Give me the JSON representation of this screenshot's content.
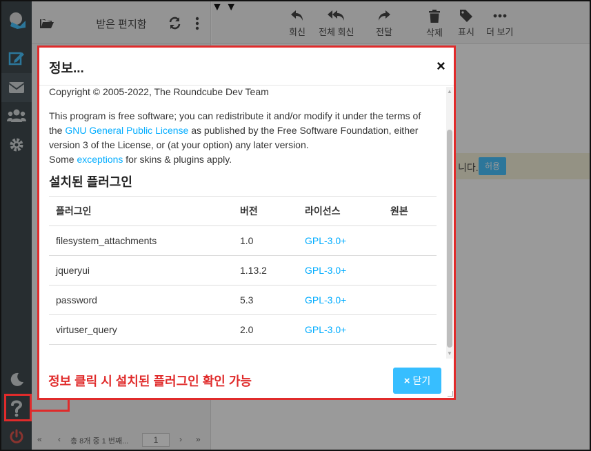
{
  "folders": {
    "title": "받은 편지함"
  },
  "toolbar": {
    "reply": "회신",
    "reply_all": "전체 회신",
    "forward": "전달",
    "delete": "삭제",
    "mark": "표시",
    "more": "더 보기"
  },
  "notice": {
    "text": "니다.",
    "allow_label": "허용"
  },
  "pager": {
    "info": "총 8개 중 1 번째...",
    "page": "1"
  },
  "dialog": {
    "title": "정보...",
    "close_symbol": "×",
    "copyright": "Copyright © 2005-2022, The Roundcube Dev Team",
    "license_part1": "This program is free software; you can redistribute it and/or modify it under the terms of the ",
    "license_link": "GNU General Public License",
    "license_part2": " as published by the Free Software Foundation, either version 3 of the License, or (at your option) any later version.",
    "some_prefix": "Some ",
    "exceptions_link": "exceptions",
    "some_suffix": " for skins & plugins apply.",
    "plugins_heading": "설치된 플러그인",
    "columns": [
      "플러그인",
      "버전",
      "라이선스",
      "원본"
    ],
    "plugins": [
      {
        "name": "filesystem_attachments",
        "version": "1.0",
        "license": "GPL-3.0+"
      },
      {
        "name": "jqueryui",
        "version": "1.13.2",
        "license": "GPL-3.0+"
      },
      {
        "name": "password",
        "version": "5.3",
        "license": "GPL-3.0+"
      },
      {
        "name": "virtuser_query",
        "version": "2.0",
        "license": "GPL-3.0+"
      }
    ],
    "annotation": "정보 클릭 시 설치된 플러그인 확인 가능",
    "close_button_x": "×",
    "close_button_label": "닫기"
  },
  "colors": {
    "accent": "#37beff",
    "link": "#00acff",
    "annotation": "#e02b2b",
    "rail": "#2f3a3f"
  },
  "icons": [
    "logo-icon",
    "compose-icon",
    "mail-icon",
    "contacts-icon",
    "settings-icon",
    "dark-mode-icon",
    "help-icon",
    "logout-icon",
    "folder-icon",
    "refresh-icon",
    "menu-dots-icon",
    "reply-icon",
    "reply-all-icon",
    "forward-icon",
    "trash-icon",
    "tag-icon",
    "more-icon"
  ]
}
